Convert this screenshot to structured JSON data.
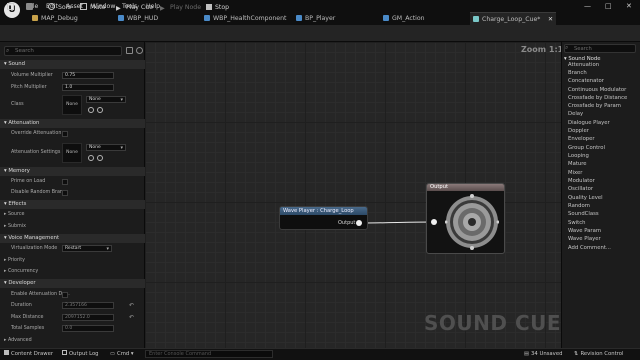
{
  "menu": [
    "File",
    "Edit",
    "Asset",
    "Window",
    "Tools",
    "Help"
  ],
  "tabs": [
    {
      "label": "MAP_Debug",
      "color": "#c8a24a"
    },
    {
      "label": "WBP_HUD",
      "color": "#4a8ac8"
    },
    {
      "label": "WBP_HealthComponent",
      "color": "#4a8ac8"
    },
    {
      "label": "BP_Player",
      "color": "#4a8ac8"
    },
    {
      "label": "GM_Action",
      "color": "#4a8ac8"
    },
    {
      "label": "Charge_Loop_Cue*",
      "color": "#7ac8c8"
    }
  ],
  "window_controls": {
    "minimize": "—",
    "maximize": "□",
    "close": "✕"
  },
  "toolbar": {
    "solo": "Solo",
    "mute": "Mute",
    "play_cue": "Play Cue",
    "play_node": "Play Node",
    "stop": "Stop"
  },
  "details": {
    "search_placeholder": "Search",
    "sound": {
      "header": "Sound",
      "volume_label": "Volume Multiplier",
      "volume_value": "0.75",
      "pitch_label": "Pitch Multiplier",
      "pitch_value": "1.0",
      "class_label": "Class",
      "class_thumb": "None",
      "class_value": "None"
    },
    "attenuation": {
      "header": "Attenuation",
      "override_label": "Override Attenuation",
      "settings_label": "Attenuation Settings",
      "settings_thumb": "None",
      "settings_value": "None"
    },
    "memory": {
      "header": "Memory",
      "prime_label": "Prime on Load",
      "disable_label": "Disable Random Bran..."
    },
    "effects_header": "Effects",
    "source_header": "Source",
    "submix_header": "Submix",
    "voice": {
      "header": "Voice Management",
      "virt_label": "Virtualization Mode",
      "virt_value": "Restart"
    },
    "priority_header": "Priority",
    "concurrency_header": "Concurrency",
    "developer": {
      "header": "Developer",
      "enable_label": "Enable Attenuation De...",
      "duration_label": "Duration",
      "duration_value": "2.357166",
      "maxdist_label": "Max Distance",
      "maxdist_value": "2097152.0",
      "samples_label": "Total Samples",
      "samples_value": "0.0"
    },
    "advanced_header": "Advanced"
  },
  "graph": {
    "zoom": "Zoom 1:1",
    "watermark": "SOUND CUE",
    "wave_node_title": "Wave Player : Charge_Loop",
    "wave_node_pin": "Output",
    "output_node_title": "Output"
  },
  "palette": {
    "search_placeholder": "Search",
    "category": "Sound Node",
    "items": [
      "Attenuation",
      "Branch",
      "Concatenator",
      "Continuous Modulator",
      "Crossfade by Distance",
      "Crossfade by Param",
      "Delay",
      "Dialogue Player",
      "Doppler",
      "Enveloper",
      "Group Control",
      "Looping",
      "Mature",
      "Mixer",
      "Modulator",
      "Oscillator",
      "Quality Level",
      "Random",
      "SoundClass",
      "Switch",
      "Wave Param",
      "Wave Player",
      "Add Comment..."
    ]
  },
  "statusbar": {
    "content_drawer": "Content Drawer",
    "output_log": "Output Log",
    "cmd": "Cmd",
    "cmd_placeholder": "Enter Console Command",
    "unsaved": "34 Unsaved",
    "revision": "Revision Control"
  },
  "colors": {
    "accent_node": "#2c4a68",
    "output_node": "#5b4d4d"
  }
}
